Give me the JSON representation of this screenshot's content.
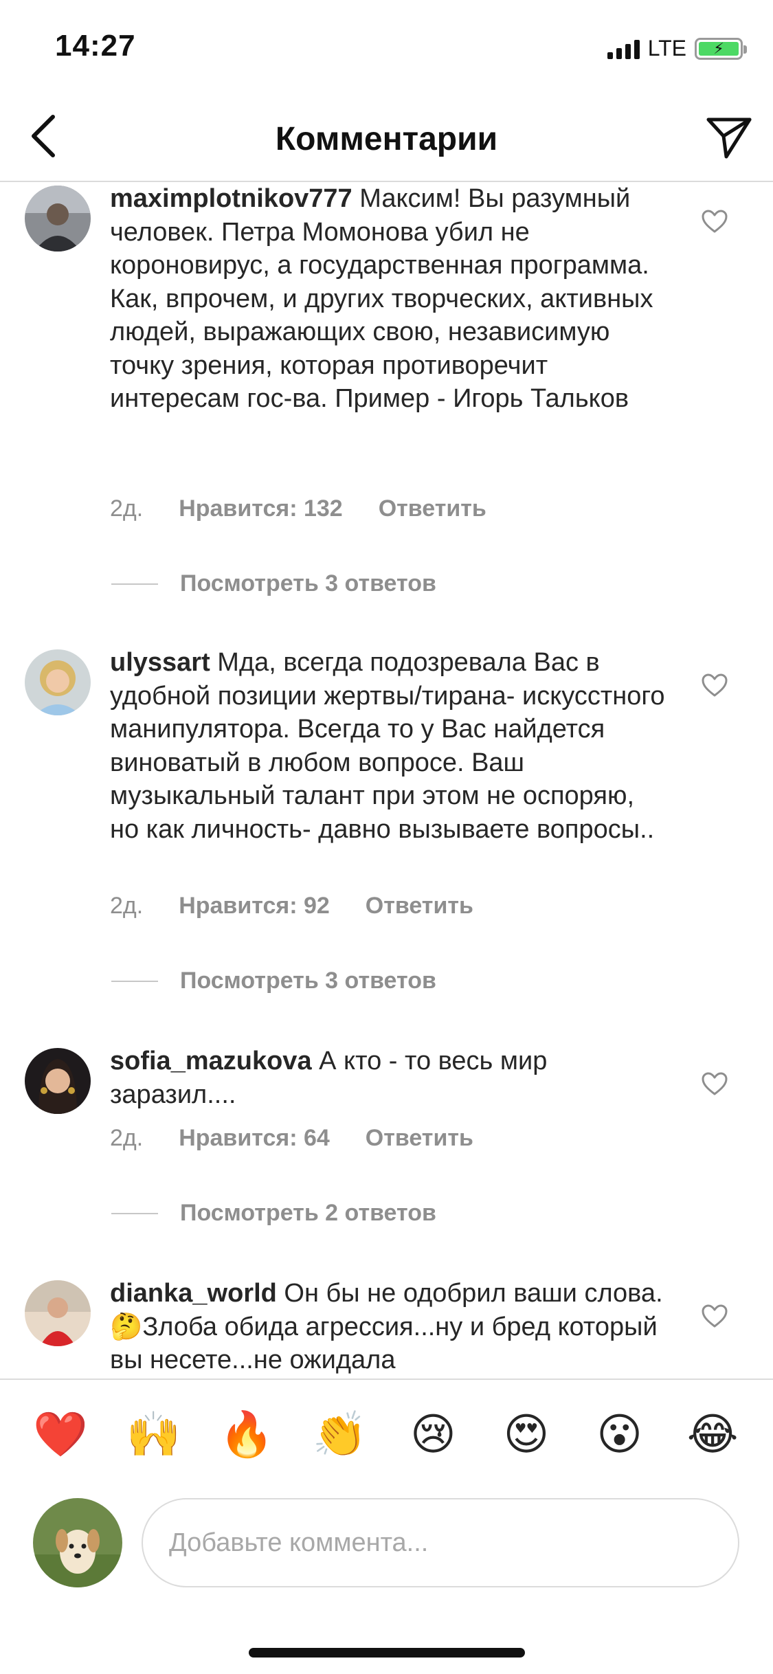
{
  "status": {
    "time": "14:27",
    "network": "LTE",
    "icons": [
      "signal-icon",
      "battery-charging-icon"
    ]
  },
  "header": {
    "title": "Комментарии",
    "back_icon": "chevron-left-icon",
    "send_icon": "paper-plane-icon"
  },
  "comments": [
    {
      "username": "maximplotnikov777",
      "text": " Максим! Вы разумный человек. Петра Момонова убил не короновирус, а государственная программа. Как, впрочем, и других творческих, активных людей, выражающих свою, независимую точку зрения, которая противоречит интересам гос-ва. Пример - Игорь Тальков",
      "time": "2д.",
      "likes": "Нравится: 132",
      "reply": "Ответить",
      "view_replies": "Посмотреть 3 ответов"
    },
    {
      "username": "ulyssart",
      "text": " Мда, всегда подозревала Вас в удобной позиции жертвы/тирана- искусстного манипулятора. Всегда то у Вас найдется виноватый в любом вопросе. Ваш музыкальный талант при этом не оспоряю, но как личность- давно вызываете вопросы..",
      "time": "2д.",
      "likes": "Нравится: 92",
      "reply": "Ответить",
      "view_replies": "Посмотреть 3 ответов"
    },
    {
      "username": "sofia_mazukova",
      "text": " А кто - то весь мир заразил....",
      "time": "2д.",
      "likes": "Нравится: 64",
      "reply": "Ответить",
      "view_replies": "Посмотреть 2 ответов"
    },
    {
      "username": "dianka_world",
      "text": " Он  бы не одобрил ваши слова.🤔Злоба обида агрессия...ну и бред который вы несете...не ожидала",
      "time": "",
      "likes": "",
      "reply": "",
      "view_replies": ""
    }
  ],
  "emoji_bar": [
    "❤️",
    "🙌",
    "🔥",
    "👏",
    "😢",
    "😍",
    "😮",
    "😂"
  ],
  "input": {
    "placeholder": "Добавьте коммента..."
  },
  "colors": {
    "text": "#262626",
    "secondary": "#8e8e8e",
    "divider": "#dbdbdb"
  }
}
